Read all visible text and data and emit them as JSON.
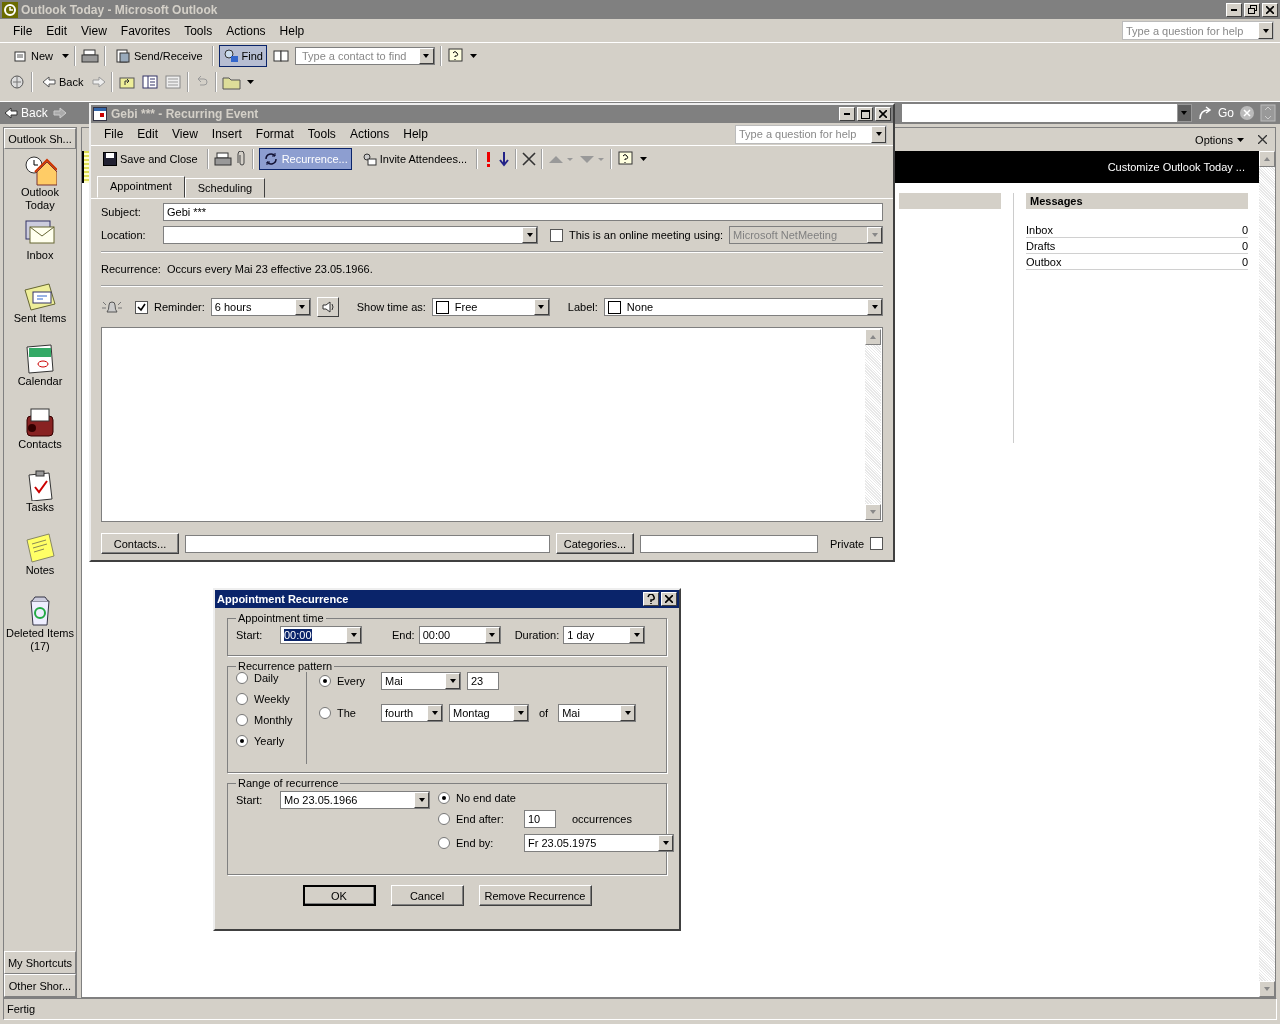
{
  "window": {
    "title": "Outlook Today - Microsoft Outlook"
  },
  "menu": [
    "File",
    "Edit",
    "View",
    "Favorites",
    "Tools",
    "Actions",
    "Help"
  ],
  "help_box": {
    "placeholder": "Type a question for help"
  },
  "toolbar": {
    "new": "New",
    "send_receive": "Send/Receive",
    "find": {
      "label": "Find",
      "selected": true
    },
    "contact_search": {
      "placeholder": "Type a contact to find"
    }
  },
  "toolbar2": {
    "back": "Back"
  },
  "web_bar": {
    "back": "Back",
    "go": "Go"
  },
  "shortcuts": {
    "header": "Outlook Sh...",
    "items": [
      {
        "label": "Outlook Today",
        "kind": "today"
      },
      {
        "label": "Inbox",
        "kind": "inbox"
      },
      {
        "label": "Sent Items",
        "kind": "sent"
      },
      {
        "label": "Calendar",
        "kind": "calendar"
      },
      {
        "label": "Contacts",
        "kind": "contacts"
      },
      {
        "label": "Tasks",
        "kind": "tasks"
      },
      {
        "label": "Notes",
        "kind": "notes"
      },
      {
        "label": "Deleted Items (17)",
        "kind": "deleted"
      }
    ],
    "groups": [
      "My Shortcuts",
      "Other Shor..."
    ]
  },
  "outlook_today": {
    "options": "Options",
    "customize": "Customize Outlook Today ...",
    "messages": {
      "title": "Messages",
      "rows": [
        {
          "name": "Inbox",
          "count": "0"
        },
        {
          "name": "Drafts",
          "count": "0"
        },
        {
          "name": "Outbox",
          "count": "0"
        }
      ]
    }
  },
  "event_window": {
    "title": "Gebi *** - Recurring Event",
    "menu": [
      "File",
      "Edit",
      "View",
      "Insert",
      "Format",
      "Tools",
      "Actions",
      "Help"
    ],
    "help_box": {
      "placeholder": "Type a question for help"
    },
    "toolbar": {
      "save": "Save and Close",
      "recurrence": {
        "label": "Recurrence...",
        "selected": true
      },
      "invite": "Invite Attendees..."
    },
    "tabs": [
      {
        "label": "Appointment",
        "selected": true
      },
      {
        "label": "Scheduling",
        "selected": false
      }
    ],
    "subject_label": "Subject:",
    "subject": "Gebi ***",
    "location_label": "Location:",
    "online_meeting": {
      "label": "This is an online meeting using:",
      "checked": false
    },
    "meeting_app": "Microsoft NetMeeting",
    "recurrence_label": "Recurrence:",
    "recurrence_text": "Occurs every Mai 23 effective 23.05.1966.",
    "reminder": {
      "label": "Reminder:",
      "checked": true,
      "value": "6 hours"
    },
    "show_time_label": "Show time as:",
    "show_time": "Free",
    "label_label": "Label:",
    "label": "None",
    "contacts_button": "Contacts...",
    "categories_button": "Categories...",
    "private": {
      "label": "Private",
      "checked": false
    }
  },
  "dialog": {
    "title": "Appointment Recurrence",
    "time": {
      "title": "Appointment time",
      "start_label": "Start:",
      "start": "00:00",
      "end_label": "End:",
      "end": "00:00",
      "duration_label": "Duration:",
      "duration": "1 day"
    },
    "pattern": {
      "title": "Recurrence pattern",
      "options": [
        {
          "label": "Daily",
          "selected": false
        },
        {
          "label": "Weekly",
          "selected": false
        },
        {
          "label": "Monthly",
          "selected": false
        },
        {
          "label": "Yearly",
          "selected": true
        }
      ],
      "every": {
        "label": "Every",
        "selected": true,
        "month": "Mai",
        "day": "23"
      },
      "the": {
        "label": "The",
        "selected": false,
        "ordinal": "fourth",
        "weekday": "Montag",
        "of_label": "of",
        "month": "Mai"
      }
    },
    "range": {
      "title": "Range of recurrence",
      "start_label": "Start:",
      "start": "Mo 23.05.1966",
      "no_end": {
        "label": "No end date",
        "selected": true
      },
      "end_after": {
        "label": "End after:",
        "selected": false,
        "value": "10",
        "suffix": "occurrences"
      },
      "end_by": {
        "label": "End by:",
        "selected": false,
        "value": "Fr 23.05.1975"
      }
    },
    "buttons": [
      "OK",
      "Cancel",
      "Remove Recurrence"
    ]
  },
  "status_bar": "Fertig"
}
